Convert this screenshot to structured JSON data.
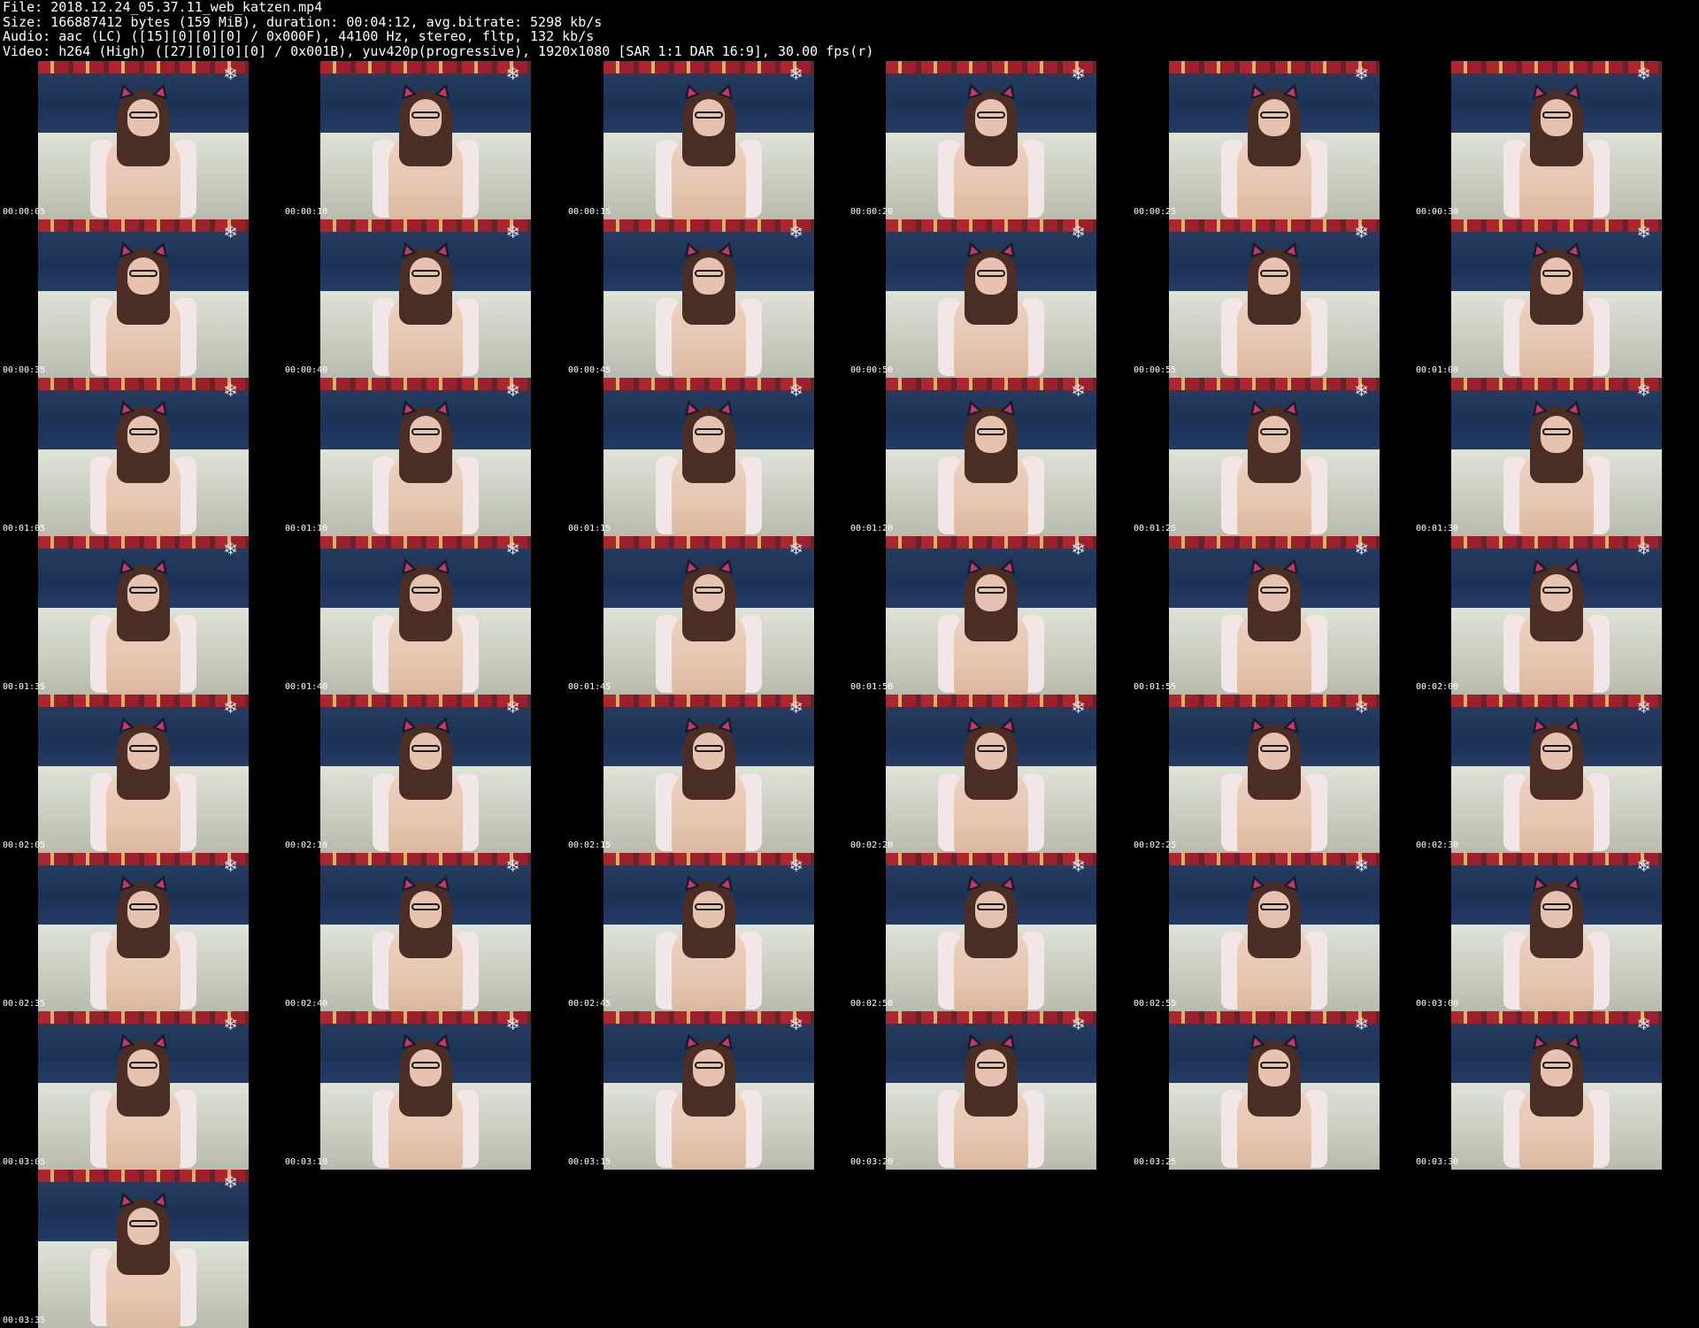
{
  "header": {
    "file_line": "File: 2018.12.24_05.37.11_web_katzen.mp4",
    "size_line": "Size: 166887412 bytes (159 MiB), duration: 00:04:12, avg.bitrate: 5298 kb/s",
    "audio_line": "Audio: aac (LC) ([15][0][0][0] / 0x000F), 44100 Hz, stereo, fltp, 132 kb/s",
    "video_line": "Video: h264 (High) ([27][0][0][0] / 0x001B), yuv420p(progressive), 1920x1080 [SAR 1:1 DAR 16:9], 30.00 fps(r)"
  },
  "thumbnails": [
    "00:00:05",
    "00:00:10",
    "00:00:15",
    "00:00:20",
    "00:00:25",
    "00:00:30",
    "00:00:35",
    "00:00:40",
    "00:00:45",
    "00:00:50",
    "00:00:55",
    "00:01:00",
    "00:01:05",
    "00:01:10",
    "00:01:15",
    "00:01:20",
    "00:01:25",
    "00:01:30",
    "00:01:35",
    "00:01:40",
    "00:01:45",
    "00:01:50",
    "00:01:55",
    "00:02:00",
    "00:02:05",
    "00:02:10",
    "00:02:15",
    "00:02:20",
    "00:02:25",
    "00:02:30",
    "00:02:35",
    "00:02:40",
    "00:02:45",
    "00:02:50",
    "00:02:55",
    "00:03:00",
    "00:03:05",
    "00:03:10",
    "00:03:15",
    "00:03:20",
    "00:03:25",
    "00:03:30",
    "00:03:35"
  ],
  "colors": {
    "background": "#000000",
    "text": "#ffffff"
  }
}
